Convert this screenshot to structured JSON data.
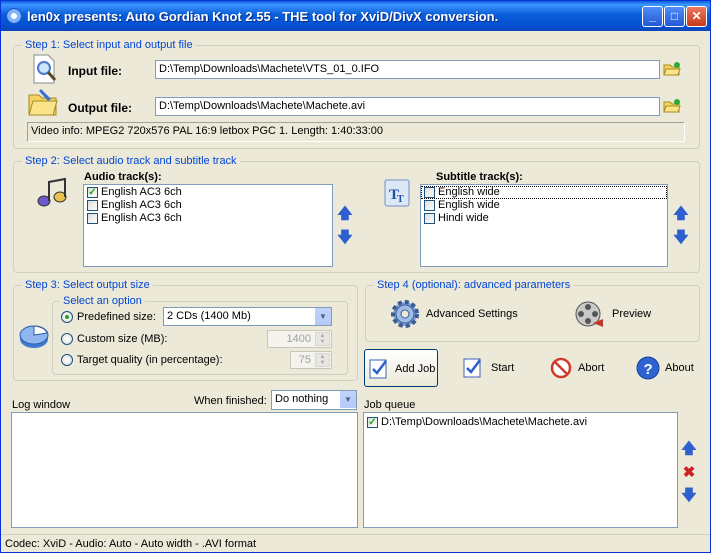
{
  "window": {
    "title": "len0x presents: Auto Gordian Knot 2.55 - THE tool for XviD/DivX conversion.",
    "minimize": "_",
    "maximize": "□",
    "close": "✕"
  },
  "step1": {
    "legend": "Step 1: Select input and output file",
    "input_label": "Input file:",
    "input_value": "D:\\Temp\\Downloads\\Machete\\VTS_01_0.IFO",
    "output_label": "Output file:",
    "output_value": "D:\\Temp\\Downloads\\Machete\\Machete.avi",
    "video_info": "Video info: MPEG2 720x576 PAL 16:9 letbox  PGC 1. Length: 1:40:33:00"
  },
  "step2": {
    "legend": "Step 2: Select audio track and subtitle track",
    "audio_label": "Audio track(s):",
    "audio_tracks": [
      {
        "label": "English AC3 6ch",
        "checked": true
      },
      {
        "label": "English AC3 6ch",
        "checked": false
      },
      {
        "label": "English AC3 6ch",
        "checked": false
      }
    ],
    "subtitle_label": "Subtitle track(s):",
    "subtitle_tracks": [
      {
        "label": "English wide",
        "checked": false
      },
      {
        "label": "English wide",
        "checked": false
      },
      {
        "label": "Hindi wide",
        "checked": false
      }
    ]
  },
  "step3": {
    "legend": "Step 3: Select output size",
    "option_legend": "Select an option",
    "predefined_label": "Predefined size:",
    "predefined_value": "2 CDs (1400 Mb)",
    "custom_label": "Custom size (MB):",
    "custom_value": "1400",
    "target_label": "Target quality (in percentage):",
    "target_value": "75"
  },
  "step4": {
    "legend": "Step 4 (optional): advanced parameters",
    "advanced_label": "Advanced Settings",
    "preview_label": "Preview"
  },
  "actions": {
    "add_job": "Add Job",
    "start": "Start",
    "abort": "Abort",
    "about": "About"
  },
  "log": {
    "label": "Log window",
    "when_finished_label": "When finished:",
    "when_finished_value": "Do nothing"
  },
  "queue": {
    "label": "Job queue",
    "items": [
      {
        "label": "D:\\Temp\\Downloads\\Machete\\Machete.avi",
        "checked": true
      }
    ]
  },
  "status": "Codec: XviD -  Audio: Auto -  Auto width - .AVI format",
  "colors": {
    "accent": "#0046d5",
    "titlebar": "#0a5fd8"
  }
}
